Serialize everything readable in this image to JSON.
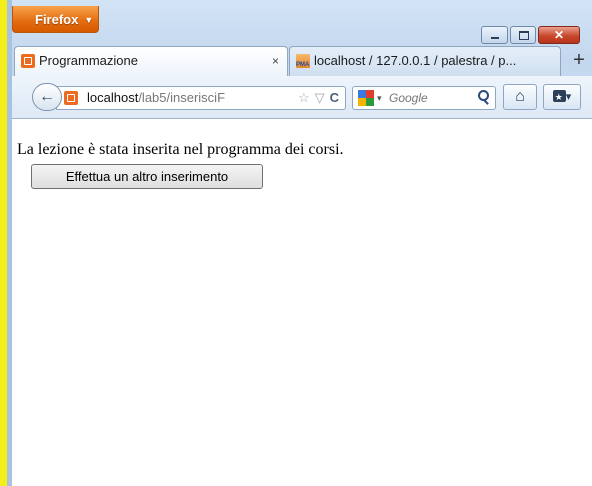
{
  "browser": {
    "menu_button_label": "Firefox",
    "window_controls": {
      "minimize_glyph": "",
      "maximize_glyph": "",
      "close_glyph": "✕"
    }
  },
  "tabs": [
    {
      "label": "Programmazione",
      "close_glyph": "×",
      "icon": "orange-square-icon",
      "active": true
    },
    {
      "label": "localhost / 127.0.0.1 / palestra / p...",
      "icon": "phpmyadmin-icon",
      "active": false
    }
  ],
  "new_tab_glyph": "+",
  "navbar": {
    "back_glyph": "🡐",
    "url_host": "localhost",
    "url_path": "/lab5/inserisciF",
    "star_glyph": "☆",
    "dropdown_glyph": "▽",
    "reload_glyph": "C",
    "search_engine_caret": "▾",
    "search_placeholder": "Google",
    "home_glyph": "⌂",
    "bookmarks_caret": "▾"
  },
  "page": {
    "message": "La lezione è stata inserita nel programma dei corsi.",
    "button_label": "Effettua un altro inserimento"
  },
  "colors": {
    "firefox_orange": "#e46b0f",
    "chrome_blue": "#c9dcf1",
    "left_highlight": "#f4ef1a",
    "close_red": "#c8482c"
  }
}
